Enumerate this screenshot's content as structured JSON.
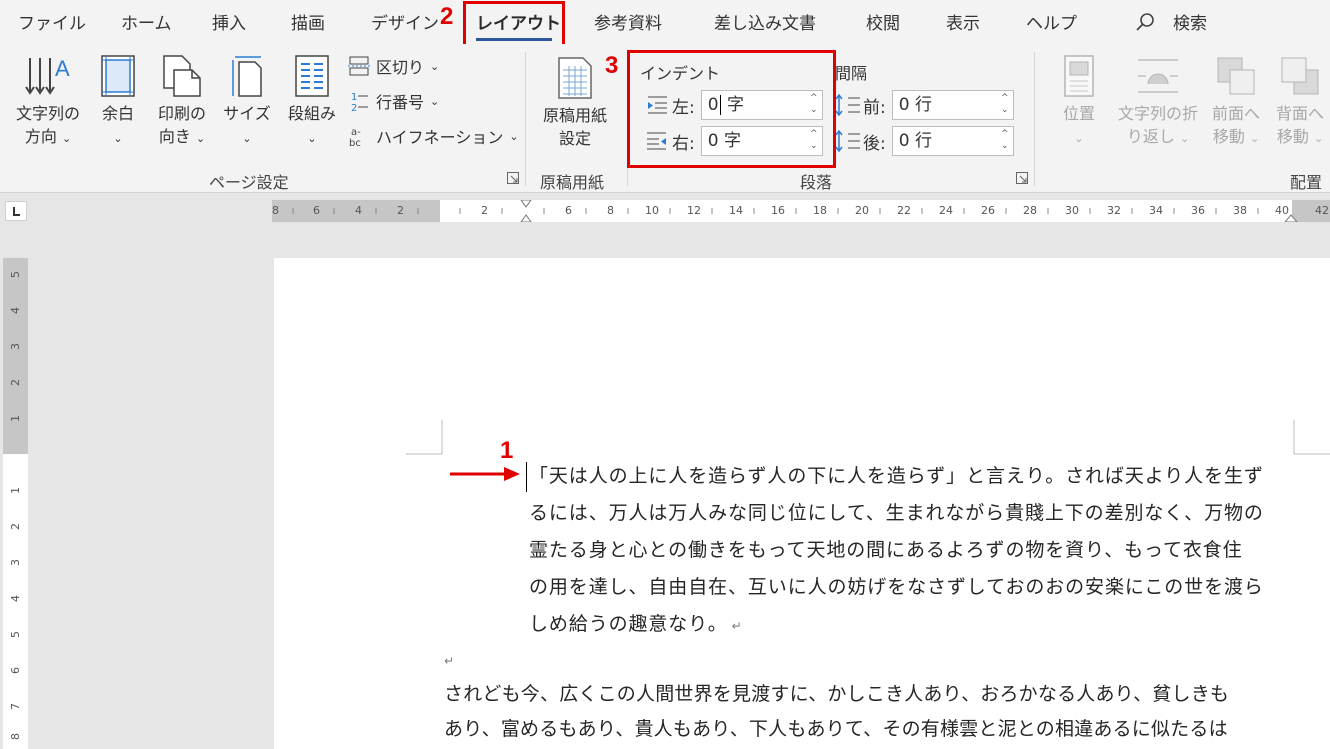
{
  "tabs": [
    "ファイル",
    "ホーム",
    "挿入",
    "描画",
    "デザイン",
    "レイアウト",
    "参考資料",
    "差し込み文書",
    "校閲",
    "表示",
    "ヘルプ"
  ],
  "search_label": "検索",
  "annotations": {
    "step1": "1",
    "step2": "2",
    "step3": "3"
  },
  "ribbon": {
    "page_setup": {
      "text_direction": [
        "文字列の",
        "方向"
      ],
      "margins": "余白",
      "orientation": [
        "印刷の",
        "向き"
      ],
      "size": "サイズ",
      "columns": "段組み",
      "breaks": "区切り",
      "line_numbers": "行番号",
      "hyphenation": "ハイフネーション",
      "label": "ページ設定"
    },
    "manuscript": {
      "button": [
        "原稿用紙",
        "設定"
      ],
      "label": "原稿用紙"
    },
    "paragraph": {
      "indent_label": "インデント",
      "spacing_label": "間隔",
      "left_label": "左:",
      "left_value": "0",
      "right_label": "右:",
      "right_value": "0 字",
      "unit_ji": "字",
      "before_label": "前:",
      "before_value": "0 行",
      "after_label": "後:",
      "after_value": "0 行",
      "label": "段落"
    },
    "arrange": {
      "position": "位置",
      "wrap_text": [
        "文字列の折",
        "り返し"
      ],
      "bring_forward": [
        "前面へ",
        "移動"
      ],
      "send_backward": [
        "背面へ",
        "移動"
      ],
      "label": "配置"
    }
  },
  "ruler": {
    "horizontal": [
      "8",
      "6",
      "4",
      "2",
      "",
      "2",
      "",
      "6",
      "8",
      "10",
      "12",
      "14",
      "16",
      "18",
      "20",
      "22",
      "24",
      "26",
      "28",
      "30",
      "32",
      "34",
      "36",
      "38",
      "40",
      "42"
    ],
    "vertical_margin": [
      "5",
      "4",
      "3",
      "2",
      "1"
    ],
    "vertical_body": [
      "1",
      "2",
      "3",
      "4",
      "5",
      "6",
      "7",
      "8"
    ]
  },
  "document": {
    "para1": [
      "「天は人の上に人を造らず人の下に人を造らず」と言えり。されば天より人を生ず",
      "るには、万人は万人みな同じ位にして、生まれながら貴賤上下の差別なく、万物の",
      "霊たる身と心との働きをもって天地の間にあるよろずの物を資り、もって衣食住",
      "の用を達し、自由自在、互いに人の妨げをなさずしておのおの安楽にこの世を渡ら",
      "しめ給うの趣意なり。"
    ],
    "para2": [
      "されども今、広くこの人間世界を見渡すに、かしこき人あり、おろかなる人あり、貧しきも",
      "あり、富めるもあり、貴人もあり、下人もありて、その有様雲と泥との相違あるに似たるは"
    ],
    "paragraph_mark": "↵"
  }
}
